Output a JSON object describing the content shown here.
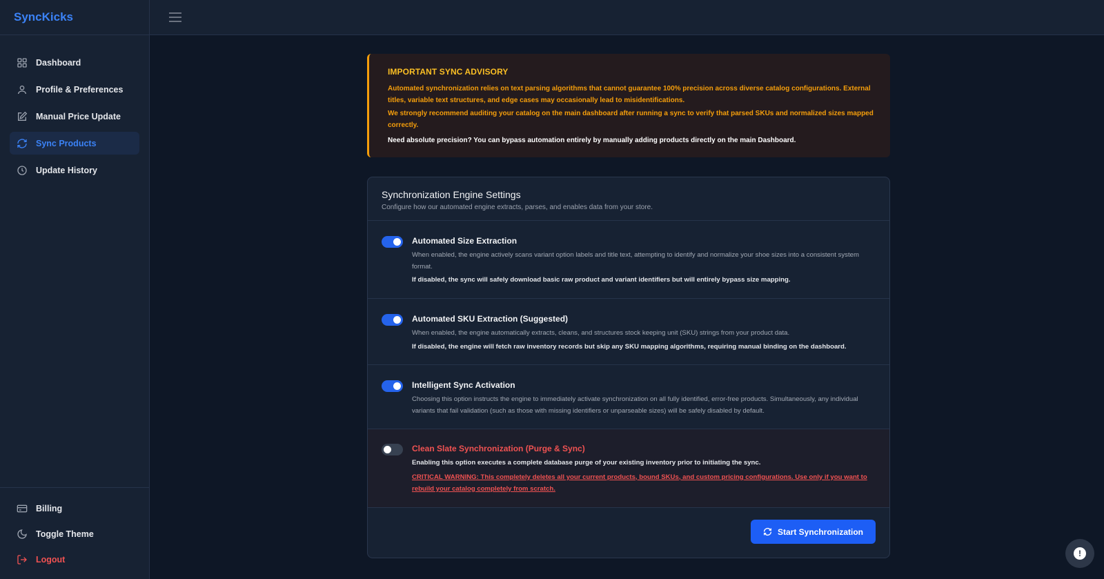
{
  "app": {
    "brand": "SyncKicks"
  },
  "sidebar": {
    "items": [
      {
        "label": "Dashboard",
        "icon": "grid-icon"
      },
      {
        "label": "Profile & Preferences",
        "icon": "user-icon"
      },
      {
        "label": "Manual Price Update",
        "icon": "edit-icon"
      },
      {
        "label": "Sync Products",
        "icon": "sync-icon",
        "active": true
      },
      {
        "label": "Update History",
        "icon": "clock-icon"
      }
    ],
    "bottom": [
      {
        "label": "Billing",
        "icon": "credit-card-icon"
      },
      {
        "label": "Toggle Theme",
        "icon": "moon-icon"
      },
      {
        "label": "Logout",
        "icon": "logout-icon"
      }
    ]
  },
  "advisory": {
    "title": "IMPORTANT SYNC ADVISORY",
    "p1": "Automated synchronization relies on text parsing algorithms that cannot guarantee 100% precision across diverse catalog configurations. External titles, variable text structures, and edge cases may occasionally lead to misidentifications.",
    "p2": "We strongly recommend auditing your catalog on the main dashboard after running a sync to verify that parsed SKUs and normalized sizes mapped correctly.",
    "note": "Need absolute precision? You can bypass automation entirely by manually adding products directly on the main Dashboard."
  },
  "settings": {
    "title": "Synchronization Engine Settings",
    "subtitle": "Configure how our automated engine extracts, parses, and enables data from your store.",
    "options": [
      {
        "title": "Automated Size Extraction",
        "desc": "When enabled, the engine actively scans variant option labels and title text, attempting to identify and normalize your shoe sizes into a consistent system format.",
        "note": "If disabled, the sync will safely download basic raw product and variant identifiers but will entirely bypass size mapping.",
        "enabled": true
      },
      {
        "title": "Automated SKU Extraction (Suggested)",
        "desc": "When enabled, the engine automatically extracts, cleans, and structures stock keeping unit (SKU) strings from your product data.",
        "note": "If disabled, the engine will fetch raw inventory records but skip any SKU mapping algorithms, requiring manual binding on the dashboard.",
        "enabled": true
      },
      {
        "title": "Intelligent Sync Activation",
        "desc": "Choosing this option instructs the engine to immediately activate synchronization on all fully identified, error-free products. Simultaneously, any individual variants that fail validation (such as those with missing identifiers or unparseable sizes) will be safely disabled by default.",
        "enabled": true
      },
      {
        "title": "Clean Slate Synchronization (Purge & Sync)",
        "desc": "Enabling this option executes a complete database purge of your existing inventory prior to initiating the sync.",
        "warning": "CRITICAL WARNING: This completely deletes all your current products, bound SKUs, and custom pricing configurations. Use only if you want to rebuild your catalog completely from scratch.",
        "enabled": false
      }
    ],
    "start_label": "Start Synchronization"
  },
  "colors": {
    "accent": "#1d5ef5",
    "brand": "#3b82f6",
    "warning": "#f59e0b",
    "danger": "#f05252"
  }
}
